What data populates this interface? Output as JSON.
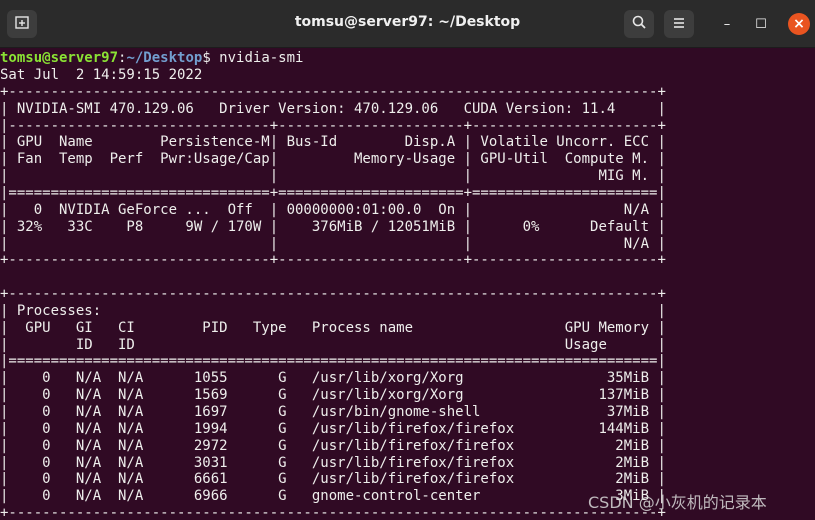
{
  "window": {
    "title": "tomsu@server97: ~/Desktop",
    "new_tab_icon": "new-tab-icon",
    "search_icon": "search-icon",
    "menu_icon": "hamburger-menu-icon",
    "minimize_glyph": "–",
    "maximize_glyph": "☐",
    "close_glyph": "×",
    "close_color": "#e95420"
  },
  "terminal": {
    "background": "#300a24",
    "prompt_user": "tomsu@server97",
    "prompt_sep": ":",
    "prompt_path": "~/Desktop",
    "prompt_symbol": "$",
    "command": " nvidia-smi",
    "output": [
      "Sat Jul  2 14:59:15 2022",
      "+-----------------------------------------------------------------------------+",
      "| NVIDIA-SMI 470.129.06   Driver Version: 470.129.06   CUDA Version: 11.4     |",
      "|-------------------------------+----------------------+----------------------+",
      "| GPU  Name        Persistence-M| Bus-Id        Disp.A | Volatile Uncorr. ECC |",
      "| Fan  Temp  Perf  Pwr:Usage/Cap|         Memory-Usage | GPU-Util  Compute M. |",
      "|                               |                      |               MIG M. |",
      "|===============================+======================+======================|",
      "|   0  NVIDIA GeForce ...  Off  | 00000000:01:00.0  On |                  N/A |",
      "| 32%   33C    P8     9W / 170W |    376MiB / 12051MiB |      0%      Default |",
      "|                               |                      |                  N/A |",
      "+-------------------------------+----------------------+----------------------+",
      "",
      "+-----------------------------------------------------------------------------+",
      "| Processes:                                                                  |",
      "|  GPU   GI   CI        PID   Type   Process name                  GPU Memory |",
      "|        ID   ID                                                   Usage      |",
      "|=============================================================================|",
      "|    0   N/A  N/A      1055      G   /usr/lib/xorg/Xorg                 35MiB |",
      "|    0   N/A  N/A      1569      G   /usr/lib/xorg/Xorg                137MiB |",
      "|    0   N/A  N/A      1697      G   /usr/bin/gnome-shell               37MiB |",
      "|    0   N/A  N/A      1994      G   /usr/lib/firefox/firefox          144MiB |",
      "|    0   N/A  N/A      2972      G   /usr/lib/firefox/firefox            2MiB |",
      "|    0   N/A  N/A      3031      G   /usr/lib/firefox/firefox            2MiB |",
      "|    0   N/A  N/A      6661      G   /usr/lib/firefox/firefox            2MiB |",
      "|    0   N/A  N/A      6966      G   gnome-control-center                3MiB |",
      "+-----------------------------------------------------------------------------+"
    ]
  },
  "watermark": "CSDN @小灰机的记录本"
}
